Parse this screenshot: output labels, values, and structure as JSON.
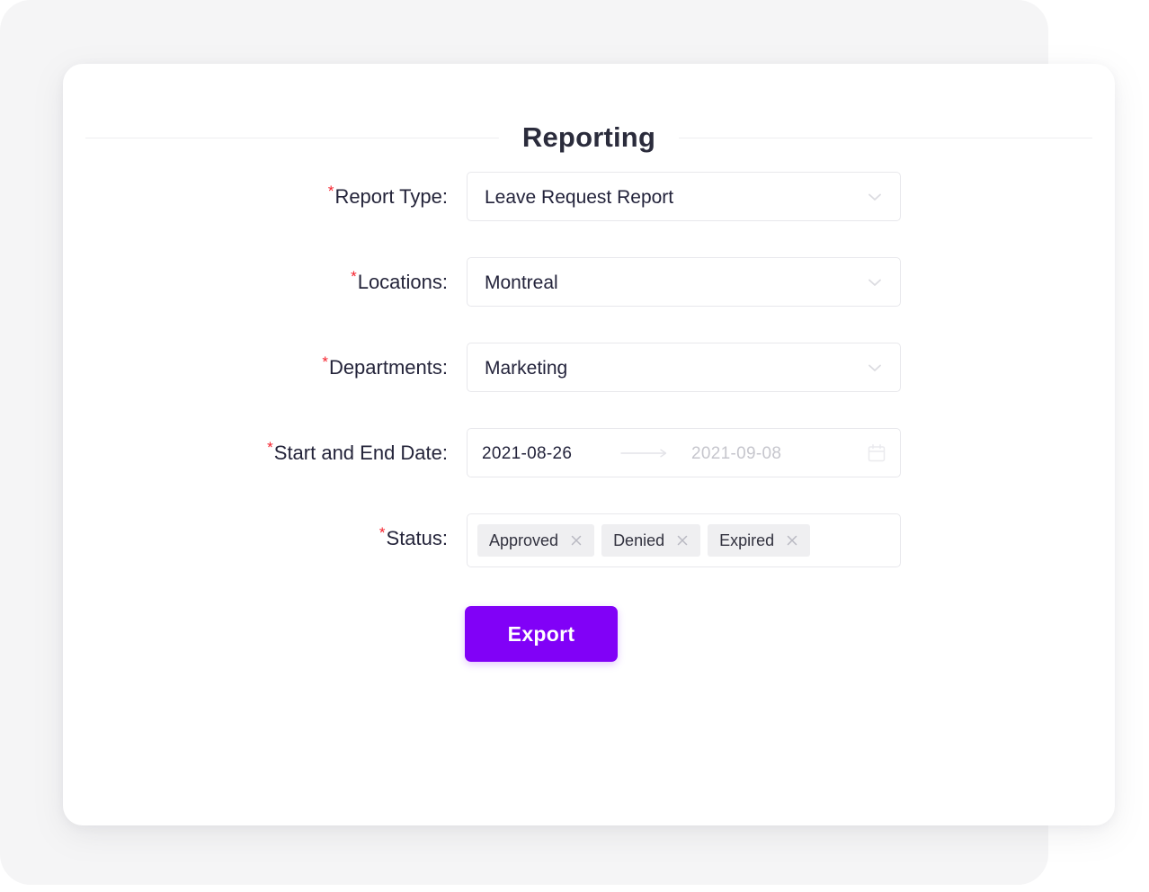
{
  "page": {
    "title": "Reporting"
  },
  "form": {
    "fields": [
      {
        "id": "report-type",
        "label": "Report Type:",
        "required": true,
        "type": "select",
        "value": "Leave Request Report",
        "icon": "chevron-down-icon"
      },
      {
        "id": "locations",
        "label": "Locations:",
        "required": true,
        "type": "select",
        "value": "Montreal",
        "icon": "chevron-down-icon"
      },
      {
        "id": "departments",
        "label": "Departments:",
        "required": true,
        "type": "select",
        "value": "Marketing",
        "icon": "chevron-down-icon"
      }
    ],
    "date_range": {
      "id": "start-end-date",
      "label": "Start and End Date:",
      "required": true,
      "start_value": "2021-08-26",
      "end_value": "2021-09-08",
      "separator_icon": "arrow-right-icon",
      "icon": "calendar-icon"
    },
    "status": {
      "id": "status",
      "label": "Status:",
      "required": true,
      "tags": [
        {
          "label": "Approved",
          "close_icon": "close-icon"
        },
        {
          "label": "Denied",
          "close_icon": "close-icon"
        },
        {
          "label": "Expired",
          "close_icon": "close-icon"
        }
      ]
    },
    "submit": {
      "label": "Export"
    },
    "required_marker": "*"
  },
  "colors": {
    "accent": "#8101f7",
    "required": "#f5222d",
    "text": "#23233b",
    "muted": "#c6c6cd",
    "border": "#e8e8ec",
    "tag_bg": "#efeff1",
    "panel_bg": "#f5f5f6",
    "card_bg": "#ffffff"
  }
}
